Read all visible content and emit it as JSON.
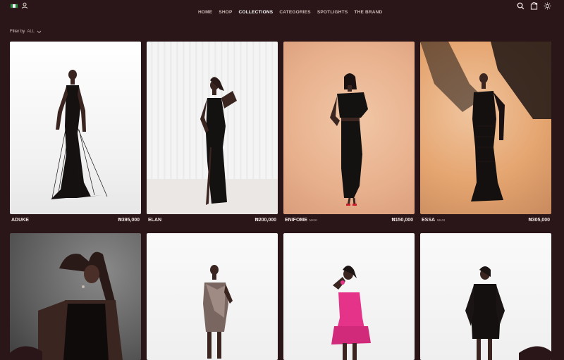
{
  "nav": {
    "items": [
      {
        "label": "HOME",
        "active": false
      },
      {
        "label": "SHOP",
        "active": false
      },
      {
        "label": "COLLECTIONS",
        "active": true
      },
      {
        "label": "CATEGORIES",
        "active": false
      },
      {
        "label": "SPOTLIGHTS",
        "active": false
      },
      {
        "label": "THE BRAND",
        "active": false
      }
    ]
  },
  "header_icons": [
    "flag-icon",
    "user-icon",
    "search-icon",
    "bag-icon",
    "theme-sun-icon"
  ],
  "filter": {
    "label": "Filter by",
    "value": "ALL"
  },
  "products": [
    {
      "name": "ADUKE",
      "tag": "",
      "price": "₦395,000"
    },
    {
      "name": "ELAN",
      "tag": "",
      "price": "₦200,000"
    },
    {
      "name": "ENIFOME",
      "tag": "MAXI",
      "price": "₦150,000"
    },
    {
      "name": "ESSA",
      "tag": "MAXI",
      "price": "₦305,000"
    },
    {
      "name": "",
      "tag": "",
      "price": ""
    },
    {
      "name": "",
      "tag": "",
      "price": ""
    },
    {
      "name": "",
      "tag": "",
      "price": ""
    },
    {
      "name": "",
      "tag": "",
      "price": ""
    }
  ],
  "colors": {
    "background": "#2a1518",
    "nav_active": "#ffffff",
    "nav_text": "#cbb9b3"
  }
}
